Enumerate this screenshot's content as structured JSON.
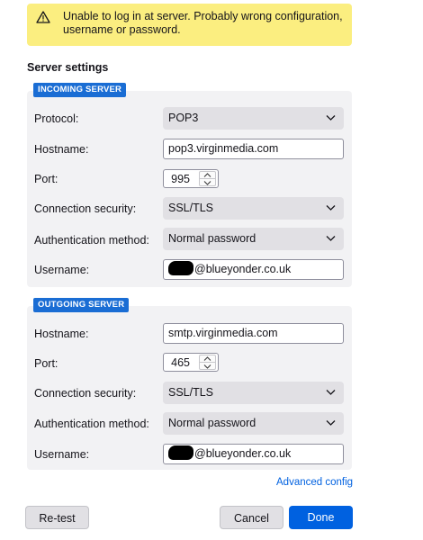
{
  "warning": {
    "icon": "warning-icon",
    "text_line1": "Unable to log in at server. Probably wrong configuration,",
    "text_line2": "username or password."
  },
  "server_settings": {
    "title": "Server settings",
    "incoming": {
      "badge": "INCOMING SERVER",
      "protocol_label": "Protocol:",
      "protocol_value": "POP3",
      "hostname_label": "Hostname:",
      "hostname_value": "pop3.virginmedia.com",
      "port_label": "Port:",
      "port_value": "995",
      "security_label": "Connection security:",
      "security_value": "SSL/TLS",
      "auth_label": "Authentication method:",
      "auth_value": "Normal password",
      "username_label": "Username:",
      "username_value": "@blueyonder.co.uk"
    },
    "outgoing": {
      "badge": "OUTGOING SERVER",
      "hostname_label": "Hostname:",
      "hostname_value": "smtp.virginmedia.com",
      "port_label": "Port:",
      "port_value": "465",
      "security_label": "Connection security:",
      "security_value": "SSL/TLS",
      "auth_label": "Authentication method:",
      "auth_value": "Normal password",
      "username_label": "Username:",
      "username_value": "@blueyonder.co.uk"
    }
  },
  "advanced_link": "Advanced config",
  "buttons": {
    "retest": "Re-test",
    "cancel": "Cancel",
    "done": "Done"
  },
  "colors": {
    "warning_bg": "#fbee80",
    "badge_bg": "#1a6dd4",
    "panel_bg": "#f2f2f4",
    "primary": "#0061e0"
  }
}
